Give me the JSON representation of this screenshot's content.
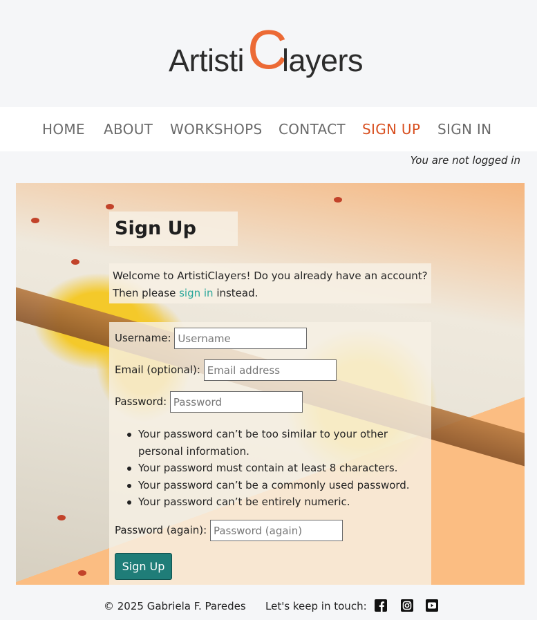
{
  "brand": {
    "part1": "Artisti",
    "big_c": "C",
    "part2": "layers",
    "accent": "#ec6a35"
  },
  "nav": {
    "items": [
      {
        "label": "HOME"
      },
      {
        "label": "ABOUT"
      },
      {
        "label": "WORKSHOPS"
      },
      {
        "label": "CONTACT"
      },
      {
        "label": "SIGN UP",
        "active": true
      },
      {
        "label": "SIGN IN"
      }
    ]
  },
  "status": "You are not logged in",
  "page": {
    "title": "Sign Up",
    "welcome_before": "Welcome to ArtistiClayers! Do you already have an account? Then please ",
    "welcome_link": "sign in",
    "welcome_after": " instead."
  },
  "form": {
    "username": {
      "label": "Username:",
      "placeholder": "Username",
      "value": ""
    },
    "email": {
      "label": "Email (optional):",
      "placeholder": "Email address",
      "value": ""
    },
    "password": {
      "label": "Password:",
      "placeholder": "Password",
      "value": ""
    },
    "help": [
      "Your password can’t be too similar to your other personal information.",
      "Your password must contain at least 8 characters.",
      "Your password can’t be a commonly used password.",
      "Your password can’t be entirely numeric."
    ],
    "password2": {
      "label": "Password (again):",
      "placeholder": "Password (again)",
      "value": ""
    },
    "submit_label": "Sign Up",
    "submit_color": "#1f7d78"
  },
  "footer": {
    "copyright": "© 2025 Gabriela F. Paredes",
    "touch_label": "Let's keep in touch:",
    "social_icons": [
      "facebook-icon",
      "instagram-icon",
      "youtube-icon"
    ]
  }
}
